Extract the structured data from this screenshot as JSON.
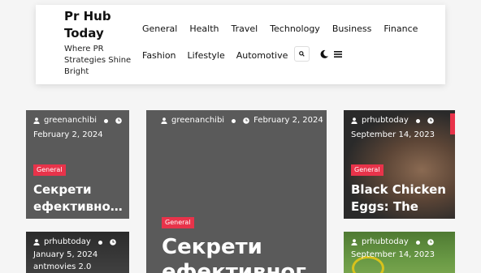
{
  "site": {
    "title": "Pr Hub Today",
    "tagline": "Where PR Strategies Shine Bright"
  },
  "nav": {
    "row1": [
      "General",
      "Health",
      "Travel",
      "Technology",
      "Business",
      "Finance"
    ],
    "row2": [
      "Fashion",
      "Lifestyle",
      "Automotive"
    ]
  },
  "icons": {
    "search": "search-icon",
    "theme": "moon-icon",
    "menu": "hamburger-menu-icon",
    "author": "user-icon",
    "date": "clock-icon"
  },
  "colors": {
    "accent": "#e8334a",
    "card_bg": "#5a5a5a"
  },
  "posts": [
    {
      "author": "greenanchibi",
      "date": "February 2, 2024",
      "category": "General",
      "title": "Секрети ефективног..."
    },
    {
      "author": "prhubtoday",
      "date": "January 5, 2024",
      "category": "",
      "title": "antmovies 2.0"
    },
    {
      "author": "greenanchibi",
      "date": "February 2, 2024",
      "category": "General",
      "title": "Секрети ефективног"
    },
    {
      "author": "prhubtoday",
      "date": "September 14, 2023",
      "category": "General",
      "title": "Black Chicken Eggs: The Rar..."
    },
    {
      "author": "prhubtoday",
      "date": "September 14, 2023",
      "category": "",
      "title": ""
    }
  ]
}
